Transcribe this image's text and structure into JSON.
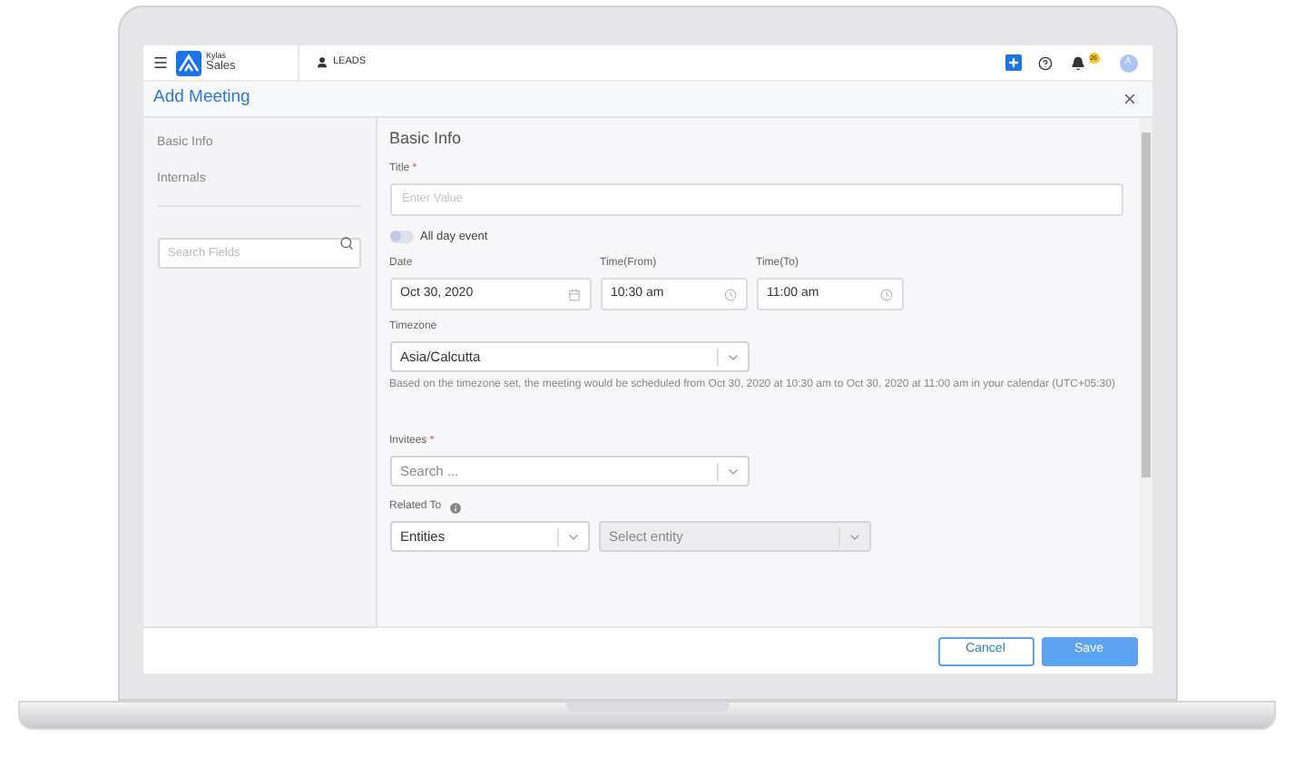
{
  "header": {
    "app_name": "Kylas",
    "app_sub": "Sales",
    "module": "LEADS",
    "notification_count": "26",
    "avatar": "A"
  },
  "dialog": {
    "title": "Add Meeting"
  },
  "sidebar": {
    "items": [
      {
        "label": "Basic Info",
        "selected": false
      },
      {
        "label": "Internals",
        "selected": false
      }
    ],
    "search": {
      "placeholder": "Search Fields"
    }
  },
  "form": {
    "section": "Basic Info",
    "title_field": {
      "label": "Title",
      "required_mark": "*",
      "placeholder": "Enter Value"
    },
    "all_day": {
      "label": "All day event",
      "on": false
    },
    "date": {
      "label": "Date",
      "value": "Oct 30, 2020"
    },
    "time_from": {
      "label": "Time(From)",
      "value": "10:30 am"
    },
    "time_to": {
      "label": "Time(To)",
      "value": "11:00 am"
    },
    "timezone": {
      "label": "Timezone",
      "value": "Asia/Calcutta"
    },
    "note": "Based on the timezone set, the meeting would be scheduled from Oct 30, 2020 at 10:30 am to Oct 30, 2020 at 11:00 am in your calendar (UTC+05:30)",
    "invitees": {
      "label": "Invitees",
      "required_mark": "*",
      "placeholder": "Search ..."
    },
    "related_to": {
      "label": "Related To",
      "entity": "Entities",
      "entity_select": {
        "placeholder": "Select entity",
        "disabled": true
      }
    }
  },
  "buttons": [
    {
      "label": "Cancel",
      "kind": "secondary"
    },
    {
      "label": "Save",
      "kind": "primary"
    }
  ]
}
